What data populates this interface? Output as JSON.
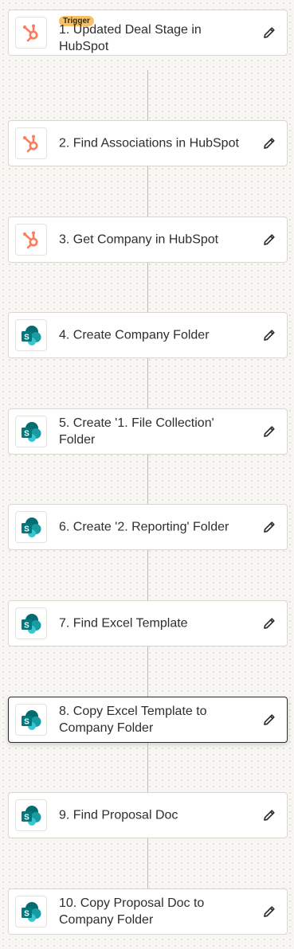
{
  "flow": {
    "trigger_badge": "Trigger",
    "steps": [
      {
        "label": "1. Updated Deal Stage in HubSpot",
        "app_icon": "hubspot-icon"
      },
      {
        "label": "2. Find Associations in HubSpot",
        "app_icon": "hubspot-icon"
      },
      {
        "label": "3. Get Company in HubSpot",
        "app_icon": "hubspot-icon"
      },
      {
        "label": "4. Create Company Folder",
        "app_icon": "sharepoint-icon"
      },
      {
        "label": "5. Create '1. File Collection' Folder",
        "app_icon": "sharepoint-icon"
      },
      {
        "label": "6. Create '2. Reporting' Folder",
        "app_icon": "sharepoint-icon"
      },
      {
        "label": "7. Find Excel Template",
        "app_icon": "sharepoint-icon"
      },
      {
        "label": "8. Copy Excel Template to Company Folder",
        "app_icon": "sharepoint-icon"
      },
      {
        "label": "9. Find Proposal Doc",
        "app_icon": "sharepoint-icon"
      },
      {
        "label": "10. Copy Proposal Doc to Company Folder",
        "app_icon": "sharepoint-icon"
      }
    ],
    "edit_icon": "pencil-icon"
  },
  "colors": {
    "hubspot": "#ff7a59",
    "sharepoint_dark": "#036c70",
    "sharepoint_mid": "#1a9ba1",
    "sharepoint_light": "#37c6d0",
    "trigger_badge": "#f9c06a",
    "selected_border": "#2d2e2e"
  }
}
